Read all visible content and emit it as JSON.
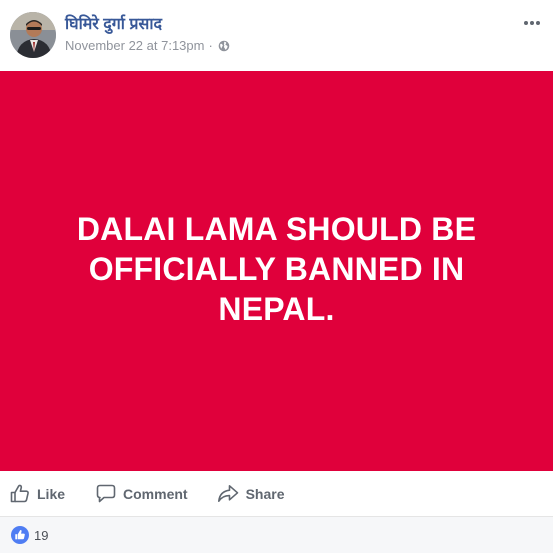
{
  "post": {
    "author": "घिमिरे दुर्गा प्रसाद",
    "timestamp": "November 22 at 7:13pm",
    "separator": "·",
    "privacy_icon": "globe-icon",
    "banner_text": "DALAI LAMA SHOULD BE\nOFFICIALLY BANNED IN\nNEPAL.",
    "banner_color": "#e0003b"
  },
  "actions": {
    "like_label": "Like",
    "comment_label": "Comment",
    "share_label": "Share"
  },
  "reactions": {
    "count": "19",
    "icon": "like-reaction-icon"
  }
}
